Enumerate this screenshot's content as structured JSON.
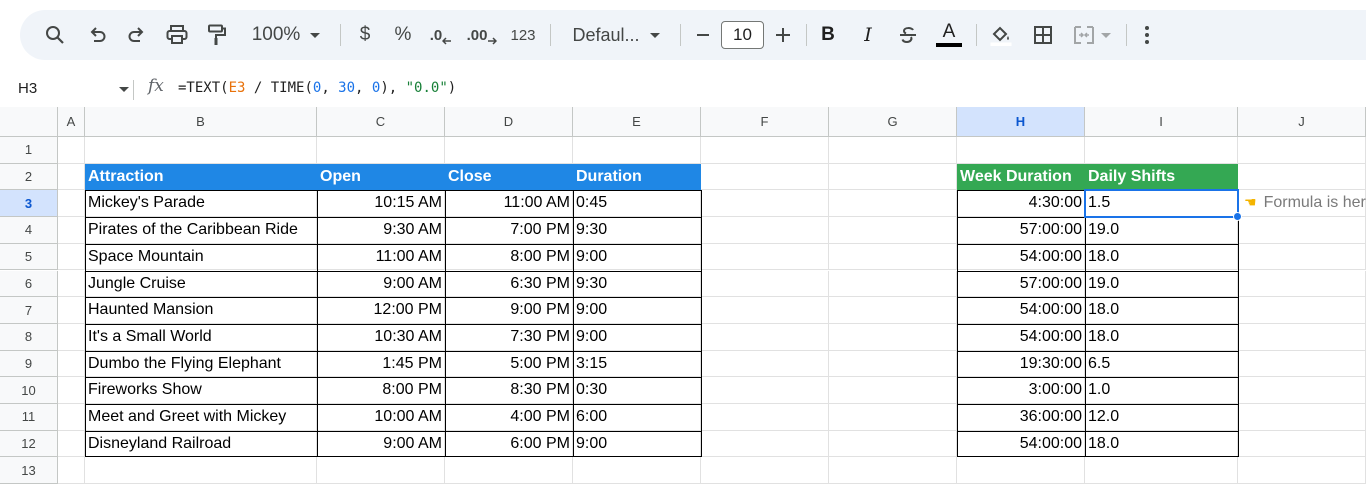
{
  "toolbar": {
    "zoom": "100%",
    "currency": "$",
    "percent": "%",
    "decrease_decimal": ".0",
    "increase_decimal": ".00",
    "number_format": "123",
    "font": "Defaul...",
    "font_size": "10",
    "bold": "B",
    "italic": "I",
    "text_color": "A"
  },
  "formula_bar": {
    "name_box": "H3",
    "fx": "fx",
    "formula": {
      "p1": "=TEXT(",
      "ref": "E3",
      "p2": " / TIME(",
      "n1": "0",
      "c1": ", ",
      "n2": "30",
      "c2": ", ",
      "n3": "0",
      "p3": "), ",
      "str": "\"0.0\"",
      "p4": ")"
    }
  },
  "columns": [
    "A",
    "B",
    "C",
    "D",
    "E",
    "F",
    "G",
    "H",
    "I",
    "J"
  ],
  "rows": [
    "1",
    "2",
    "3",
    "4",
    "5",
    "6",
    "7",
    "8",
    "9",
    "10",
    "11",
    "12",
    "13"
  ],
  "selected_column": "H",
  "selected_row": "3",
  "table1": {
    "headers": [
      "Attraction",
      "Open",
      "Close",
      "Duration"
    ],
    "rows": [
      [
        "Mickey's Parade",
        "10:15 AM",
        "11:00 AM",
        "0:45"
      ],
      [
        "Pirates of the Caribbean Ride",
        "9:30 AM",
        "7:00 PM",
        "9:30"
      ],
      [
        "Space Mountain",
        "11:00 AM",
        "8:00 PM",
        "9:00"
      ],
      [
        "Jungle Cruise",
        "9:00 AM",
        "6:30 PM",
        "9:30"
      ],
      [
        "Haunted Mansion",
        "12:00 PM",
        "9:00 PM",
        "9:00"
      ],
      [
        "It's a Small World",
        "10:30 AM",
        "7:30 PM",
        "9:00"
      ],
      [
        "Dumbo the Flying Elephant",
        "1:45 PM",
        "5:00 PM",
        "3:15"
      ],
      [
        "Fireworks Show",
        "8:00 PM",
        "8:30 PM",
        "0:30"
      ],
      [
        "Meet and Greet with Mickey",
        "10:00 AM",
        "4:00 PM",
        "6:00"
      ],
      [
        "Disneyland Railroad",
        "9:00 AM",
        "6:00 PM",
        "9:00"
      ]
    ]
  },
  "table2": {
    "headers": [
      "Week Duration",
      "Daily Shifts"
    ],
    "rows": [
      [
        "4:30:00",
        "1.5"
      ],
      [
        "57:00:00",
        "19.0"
      ],
      [
        "54:00:00",
        "18.0"
      ],
      [
        "57:00:00",
        "19.0"
      ],
      [
        "54:00:00",
        "18.0"
      ],
      [
        "54:00:00",
        "18.0"
      ],
      [
        "19:30:00",
        "6.5"
      ],
      [
        "3:00:00",
        "1.0"
      ],
      [
        "36:00:00",
        "12.0"
      ],
      [
        "54:00:00",
        "18.0"
      ]
    ]
  },
  "note": "Formula is here",
  "colors": {
    "header_blue": "#1f87e5",
    "header_green": "#34a853",
    "selection": "#1a73e8"
  }
}
